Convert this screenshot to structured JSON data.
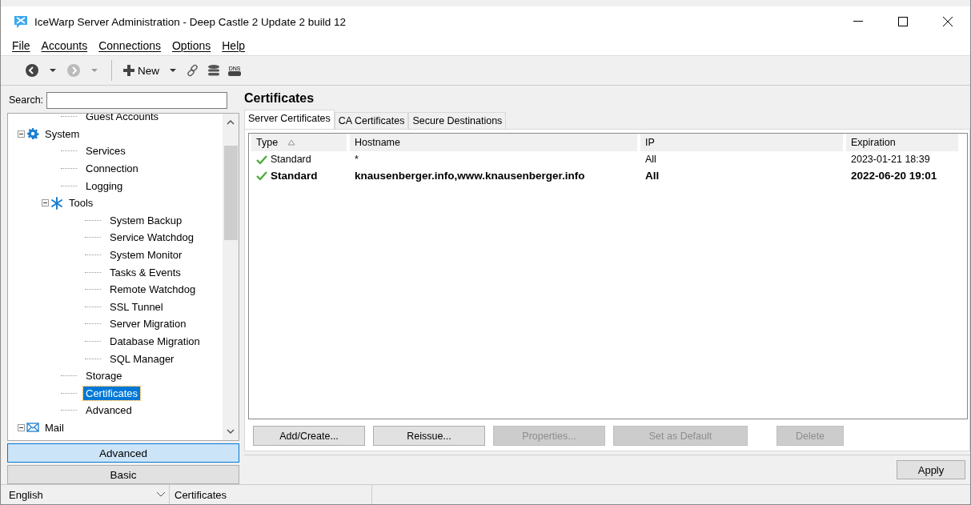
{
  "window": {
    "title": "IceWarp Server Administration - Deep Castle 2 Update 2 build 12"
  },
  "menu": [
    "File",
    "Accounts",
    "Connections",
    "Options",
    "Help"
  ],
  "toolbar": {
    "new_label": "New",
    "dns_label": "DNS"
  },
  "search": {
    "label": "Search:"
  },
  "tree": [
    {
      "children": [
        {
          "label": "Guest Accounts",
          "selected": false
        }
      ]
    },
    {
      "label": "System",
      "kind": "gear",
      "expanded": true,
      "selected": false,
      "children": [
        {
          "label": "Services",
          "selected": false
        },
        {
          "label": "Connection",
          "selected": false
        },
        {
          "label": "Logging",
          "selected": false
        },
        {
          "label": "Tools",
          "kind": "asterisk",
          "expanded": true,
          "selected": false,
          "children": [
            {
              "label": "System Backup",
              "selected": false
            },
            {
              "label": "Service Watchdog",
              "selected": false
            },
            {
              "label": "System Monitor",
              "selected": false
            },
            {
              "label": "Tasks & Events",
              "selected": false
            },
            {
              "label": "Remote Watchdog",
              "selected": false
            },
            {
              "label": "SSL Tunnel",
              "selected": false
            },
            {
              "label": "Server Migration",
              "selected": false
            },
            {
              "label": "Database Migration",
              "selected": false
            },
            {
              "label": "SQL Manager",
              "selected": false
            }
          ]
        },
        {
          "label": "Storage",
          "selected": false
        },
        {
          "label": "Certificates",
          "selected": true
        },
        {
          "label": "Advanced",
          "selected": false
        }
      ]
    },
    {
      "label": "Mail",
      "kind": "envelope",
      "expanded": true,
      "selected": false
    }
  ],
  "modes": [
    {
      "label": "Advanced",
      "selected": true
    },
    {
      "label": "Basic",
      "selected": false
    }
  ],
  "page": {
    "title": "Certificates"
  },
  "tabs": [
    {
      "label": "Server Certificates",
      "selected": true
    },
    {
      "label": "CA Certificates",
      "selected": false
    },
    {
      "label": "Secure Destinations",
      "selected": false
    }
  ],
  "table": {
    "columns": [
      "Type",
      "Hostname",
      "IP",
      "Expiration"
    ],
    "rows": [
      {
        "cells": [
          "Standard",
          "*",
          "All",
          "2023-01-21 18:39"
        ],
        "valid": true,
        "default": false
      },
      {
        "cells": [
          "Standard",
          "knausenberger.info,www.knausenberger.info",
          "All",
          "2022-06-20 19:01"
        ],
        "valid": true,
        "default": true
      }
    ]
  },
  "buttons": [
    {
      "label": "Add/Create...",
      "disabled": false
    },
    {
      "label": "Reissue...",
      "disabled": false
    },
    {
      "label": "Properties...",
      "disabled": true
    },
    {
      "label": "Set as Default",
      "disabled": true
    },
    {
      "label": "Delete",
      "disabled": true
    }
  ],
  "apply": {
    "label": "Apply"
  },
  "status_bar": {
    "language": "English",
    "section": "Certificates"
  }
}
